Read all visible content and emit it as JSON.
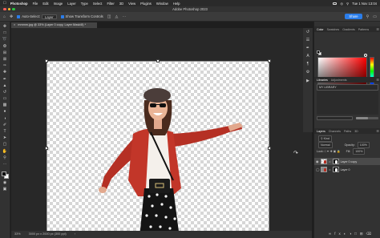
{
  "menubar": {
    "app_name": "Photoshop",
    "items": [
      "File",
      "Edit",
      "Image",
      "Layer",
      "Type",
      "Select",
      "Filter",
      "3D",
      "View",
      "Plugins",
      "Window",
      "Help"
    ],
    "clock": "Tue 1 Nov 13:04"
  },
  "window": {
    "title": "Adobe Photoshop 2023"
  },
  "options": {
    "auto_select_label": "Auto-Select:",
    "auto_select_value": "Layer",
    "show_transform_label": "Show Transform Controls",
    "share_label": "Share"
  },
  "document": {
    "tab_title": "mmmm.jpg @ 33% (Layer 0 copy, Layer Mask/8) *",
    "zoom": "33%",
    "size_info": "3000 px x 2000 px (300 ppi)"
  },
  "panels": {
    "color_tabs": [
      "Color",
      "Swatches",
      "Gradients",
      "Patterns"
    ],
    "library_tabs": [
      "Libraries",
      "Adjustments"
    ],
    "library_name": "MY LIBRARY",
    "layers_tabs": [
      "Layers",
      "Channels",
      "Paths",
      "3D"
    ],
    "kind_label": "Kind",
    "blend_mode": "Normal",
    "opacity_label": "Opacity:",
    "opacity_value": "100%",
    "lock_label": "Lock:",
    "fill_label": "Fill:",
    "fill_value": "100%",
    "layers": [
      {
        "name": "Layer 0 copy",
        "selected": true
      },
      {
        "name": "Layer 0",
        "selected": false
      }
    ]
  },
  "colors": {
    "accent": "#2b7de9",
    "jacket": "#b53024"
  },
  "icons": {
    "tools": [
      "move-icon",
      "marquee-icon",
      "lasso-icon",
      "quick-select-icon",
      "crop-icon",
      "frame-icon",
      "eyedropper-icon",
      "healing-icon",
      "brush-icon",
      "clone-stamp-icon",
      "history-brush-icon",
      "eraser-icon",
      "gradient-icon",
      "blur-icon",
      "dodge-icon",
      "pen-icon",
      "type-icon",
      "path-select-icon",
      "rectangle-icon",
      "hand-icon",
      "zoom-icon"
    ]
  }
}
